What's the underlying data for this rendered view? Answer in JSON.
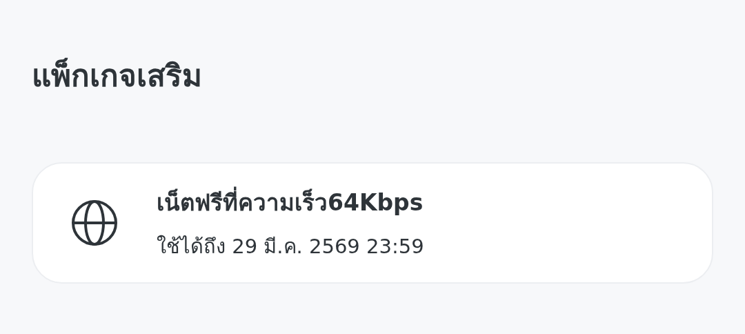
{
  "section_title": "แพ็กเกจเสริม",
  "packages": [
    {
      "name": "เน็ตฟรีที่ความเร็ว64Kbps",
      "validity": "ใช้ได้ถึง 29 มี.ค. 2569 23:59"
    }
  ]
}
